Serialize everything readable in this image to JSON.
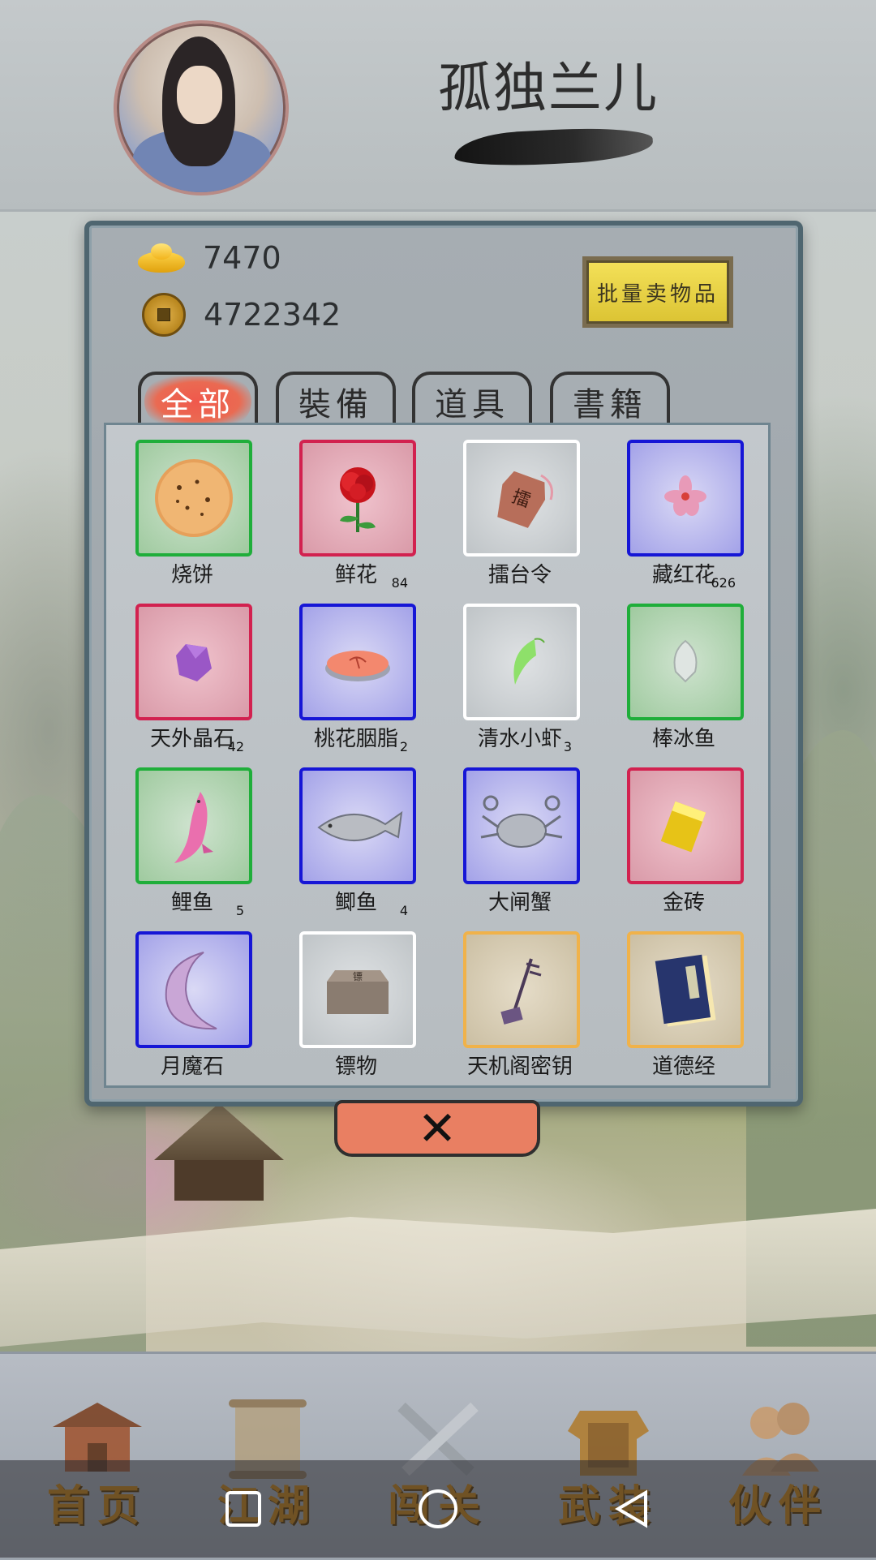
{
  "player": {
    "name": "孤独兰儿"
  },
  "currency": {
    "ingots": "7470",
    "coins": "4722342"
  },
  "actions": {
    "bulk_sell": "批量卖物品"
  },
  "tabs": [
    {
      "label": "全部",
      "active": true
    },
    {
      "label": "裝備",
      "active": false
    },
    {
      "label": "道具",
      "active": false
    },
    {
      "label": "書籍",
      "active": false
    }
  ],
  "items": [
    {
      "name": "烧饼",
      "count": "",
      "rarity": "green",
      "icon": "flatbread-icon"
    },
    {
      "name": "鲜花",
      "count": "84",
      "rarity": "red",
      "icon": "rose-icon"
    },
    {
      "name": "擂台令",
      "count": "",
      "rarity": "white",
      "icon": "token-icon"
    },
    {
      "name": "藏红花",
      "count": "626",
      "rarity": "blue",
      "icon": "saffron-icon"
    },
    {
      "name": "天外晶石",
      "count": "42",
      "rarity": "red",
      "icon": "crystal-icon"
    },
    {
      "name": "桃花胭脂",
      "count": "2",
      "rarity": "blue",
      "icon": "rouge-icon"
    },
    {
      "name": "清水小虾",
      "count": "3",
      "rarity": "white",
      "icon": "shrimp-icon"
    },
    {
      "name": "棒冰鱼",
      "count": "",
      "rarity": "green",
      "icon": "ice-fish-icon"
    },
    {
      "name": "鲤鱼",
      "count": "5",
      "rarity": "green",
      "icon": "carp-icon"
    },
    {
      "name": "鲫鱼",
      "count": "4",
      "rarity": "blue",
      "icon": "crucian-icon"
    },
    {
      "name": "大闸蟹",
      "count": "",
      "rarity": "blue",
      "icon": "crab-icon"
    },
    {
      "name": "金砖",
      "count": "",
      "rarity": "red",
      "icon": "gold-brick-icon"
    },
    {
      "name": "月魔石",
      "count": "",
      "rarity": "blue",
      "icon": "moon-stone-icon"
    },
    {
      "name": "镖物",
      "count": "",
      "rarity": "white",
      "icon": "escort-box-icon"
    },
    {
      "name": "天机阁密钥",
      "count": "",
      "rarity": "orange",
      "icon": "erhu-key-icon"
    },
    {
      "name": "道德经",
      "count": "",
      "rarity": "orange",
      "icon": "book-icon"
    }
  ],
  "close_label": "✕",
  "nav": [
    {
      "label": "首页",
      "icon": "home-pavilion-icon"
    },
    {
      "label": "江湖",
      "icon": "scroll-icon"
    },
    {
      "label": "闯关",
      "icon": "crossed-swords-icon"
    },
    {
      "label": "武装",
      "icon": "armor-icon"
    },
    {
      "label": "伙伴",
      "icon": "companions-icon"
    }
  ],
  "colors": {
    "rarity_green": "#1fae3a",
    "rarity_red": "#d2214f",
    "rarity_white": "#ffffff",
    "rarity_blue": "#1616d6",
    "rarity_orange": "#f0b24a",
    "sell_button": "#f3e058",
    "close_button": "#e97f62"
  }
}
